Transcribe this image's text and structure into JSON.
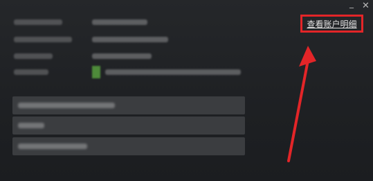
{
  "window": {
    "minimize_glyph": "_",
    "close_glyph": "✕"
  },
  "account": {
    "details_link": "查看账户明细"
  },
  "colors": {
    "highlight_box": "#e32528",
    "arrow": "#e32528",
    "background": "#1f2124",
    "button_bg": "#3b3d40"
  }
}
